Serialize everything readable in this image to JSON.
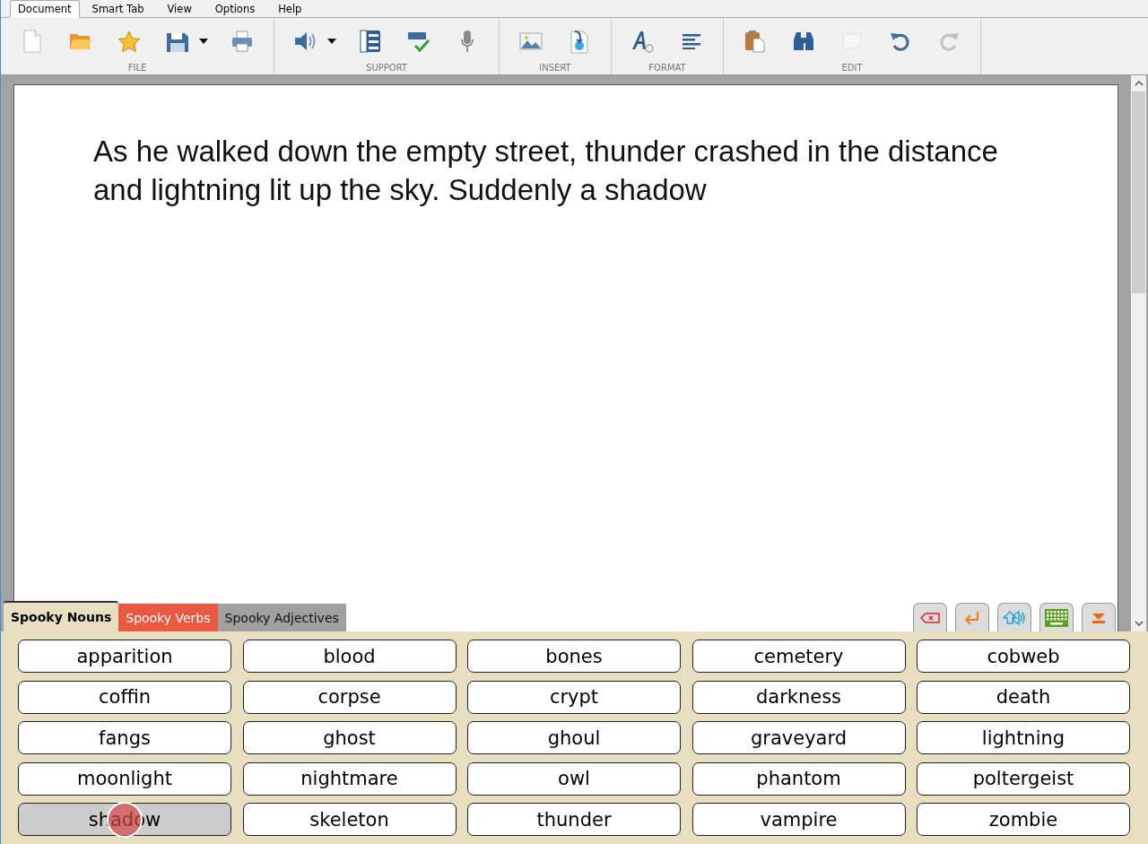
{
  "menu_tabs": [
    {
      "label": "Document",
      "selected": true
    },
    {
      "label": "Smart Tab",
      "selected": false
    },
    {
      "label": "View",
      "selected": false
    },
    {
      "label": "Options",
      "selected": false
    },
    {
      "label": "Help",
      "selected": false
    }
  ],
  "toolbar_groups": [
    {
      "label": "FILE",
      "buttons": [
        {
          "kind": "new",
          "disabled": false
        },
        {
          "kind": "open",
          "disabled": false
        },
        {
          "kind": "favorite",
          "disabled": false
        },
        {
          "kind": "save",
          "disabled": false
        },
        {
          "kind": "dropdown",
          "disabled": false
        },
        {
          "kind": "print",
          "disabled": false
        }
      ]
    },
    {
      "label": "SUPPORT",
      "buttons": [
        {
          "kind": "speak",
          "disabled": false
        },
        {
          "kind": "dropdown",
          "disabled": false
        },
        {
          "kind": "list",
          "disabled": false
        },
        {
          "kind": "spell",
          "disabled": false
        },
        {
          "kind": "mic",
          "disabled": false
        }
      ]
    },
    {
      "label": "INSERT",
      "buttons": [
        {
          "kind": "image",
          "disabled": false
        },
        {
          "kind": "import",
          "disabled": false
        }
      ]
    },
    {
      "label": "FORMAT",
      "buttons": [
        {
          "kind": "font",
          "disabled": false
        },
        {
          "kind": "align",
          "disabled": false
        }
      ]
    },
    {
      "label": "EDIT",
      "buttons": [
        {
          "kind": "paste",
          "disabled": false
        },
        {
          "kind": "find",
          "disabled": false
        },
        {
          "kind": "note",
          "disabled": true
        },
        {
          "kind": "undo",
          "disabled": false
        },
        {
          "kind": "redo",
          "disabled": true
        }
      ]
    }
  ],
  "document": {
    "text": "As he walked down the empty street, thunder crashed in the distance and lightning lit up the sky. Suddenly a shadow"
  },
  "word_bank": {
    "tabs": [
      {
        "label": "Spooky Nouns",
        "selected": true,
        "color": "#e8dfc0"
      },
      {
        "label": "Spooky Verbs",
        "selected": false,
        "color": "#ea5840"
      },
      {
        "label": "Spooky Adjectives",
        "selected": false,
        "color": "#a0a0a0"
      }
    ],
    "tools": [
      {
        "kind": "delete"
      },
      {
        "kind": "enter"
      },
      {
        "kind": "speak"
      },
      {
        "kind": "keyboard"
      },
      {
        "kind": "hide"
      }
    ],
    "words": [
      {
        "label": "apparition",
        "selected": false
      },
      {
        "label": "blood",
        "selected": false
      },
      {
        "label": "bones",
        "selected": false
      },
      {
        "label": "cemetery",
        "selected": false
      },
      {
        "label": "cobweb",
        "selected": false
      },
      {
        "label": "coffin",
        "selected": false
      },
      {
        "label": "corpse",
        "selected": false
      },
      {
        "label": "crypt",
        "selected": false
      },
      {
        "label": "darkness",
        "selected": false
      },
      {
        "label": "death",
        "selected": false
      },
      {
        "label": "fangs",
        "selected": false
      },
      {
        "label": "ghost",
        "selected": false
      },
      {
        "label": "ghoul",
        "selected": false
      },
      {
        "label": "graveyard",
        "selected": false
      },
      {
        "label": "lightning",
        "selected": false
      },
      {
        "label": "moonlight",
        "selected": false
      },
      {
        "label": "nightmare",
        "selected": false
      },
      {
        "label": "owl",
        "selected": false
      },
      {
        "label": "phantom",
        "selected": false
      },
      {
        "label": "poltergeist",
        "selected": false
      },
      {
        "label": "shadow",
        "selected": true
      },
      {
        "label": "skeleton",
        "selected": false
      },
      {
        "label": "thunder",
        "selected": false
      },
      {
        "label": "vampire",
        "selected": false
      },
      {
        "label": "zombie",
        "selected": false
      }
    ]
  }
}
